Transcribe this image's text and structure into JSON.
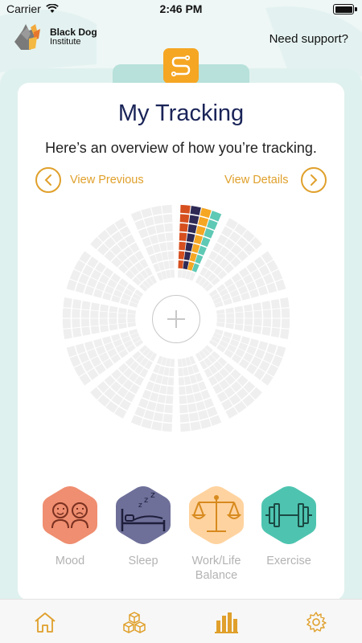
{
  "status_bar": {
    "carrier": "Carrier",
    "time": "2:46 PM"
  },
  "header": {
    "logo_line1": "Black Dog",
    "logo_line2": "Institute",
    "support_link": "Need support?"
  },
  "main": {
    "title": "My Tracking",
    "subtitle": "Here’s an overview of how you’re tracking.",
    "prev_label": "View Previous",
    "next_label": "View Details"
  },
  "categories": [
    {
      "label": "Mood",
      "icon": "mood-faces-icon",
      "color": "#ef8e70"
    },
    {
      "label": "Sleep",
      "icon": "sleep-bed-icon",
      "color": "#6e7099"
    },
    {
      "label": "Work/Life Balance",
      "icon": "balance-scale-icon",
      "color": "#ffd39f"
    },
    {
      "label": "Exercise",
      "icon": "dumbbell-icon",
      "color": "#4ec4b0"
    }
  ],
  "tabbar": {
    "items": [
      {
        "icon": "home-icon"
      },
      {
        "icon": "cubes-icon"
      },
      {
        "icon": "bar-chart-icon",
        "active": true
      },
      {
        "icon": "gear-icon"
      }
    ]
  },
  "colors": {
    "accent": "#e0a02b",
    "title": "#1a2458",
    "mood": "#d64f1e",
    "sleep": "#2e2a55",
    "worklife": "#f5a623",
    "exercise": "#5ec9b5",
    "empty_segment": "#efefef"
  }
}
